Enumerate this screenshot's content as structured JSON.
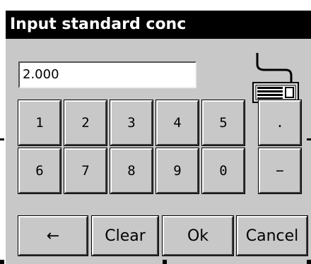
{
  "dialog": {
    "title": "Input standard conc",
    "value": "2.000"
  },
  "keypad": {
    "row1": [
      "1",
      "2",
      "3",
      "4",
      "5"
    ],
    "row2": [
      "6",
      "7",
      "8",
      "9",
      "0"
    ],
    "decimal": ".",
    "minus": "−"
  },
  "actions": {
    "backspace": "←",
    "clear": "Clear",
    "ok": "Ok",
    "cancel": "Cancel"
  },
  "icons": {
    "keyboard": "keyboard-icon"
  }
}
